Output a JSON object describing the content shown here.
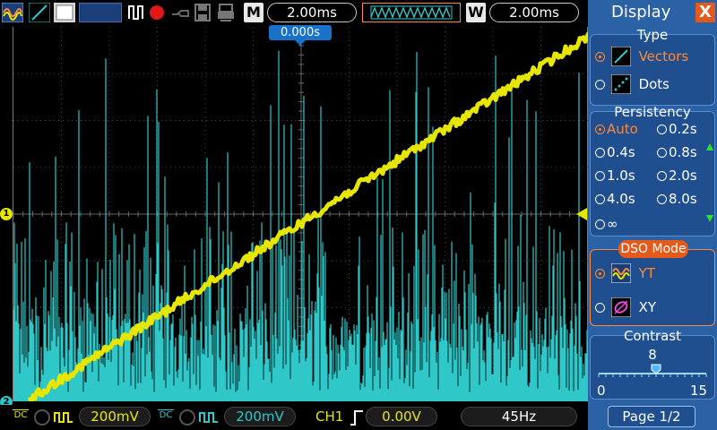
{
  "colors": {
    "ch1": "#e6e600",
    "ch2": "#2fc7c7",
    "accent": "#ff8a3c",
    "menu_bg": "#2b62a6",
    "trigger_marker": "#1a72c8"
  },
  "toolbar": {
    "icons": [
      "cursor-measure-icon",
      "vectors-display-icon",
      "color-grid-icon",
      "run-stop-icon",
      "record-icon",
      "probe-icon",
      "save-icon",
      "print-icon"
    ],
    "memory_label": "M",
    "memory_timebase": "2.00ms",
    "window_label": "W",
    "window_timebase": "2.00ms"
  },
  "screen": {
    "trigger_position": "0.000s",
    "ch1_marker": "1",
    "ch2_marker": "2"
  },
  "bottom": {
    "ch1_coupling": "DC",
    "ch1_scale": "200mV",
    "ch2_coupling": "DC",
    "ch2_scale": "200mV",
    "trigger_source": "CH1",
    "trigger_edge_icon": "rising-edge-icon",
    "trigger_level": "0.00V",
    "frequency": "45Hz"
  },
  "menu": {
    "title": "Display",
    "close_label": "X",
    "type": {
      "title": "Type",
      "options": [
        {
          "label": "Vectors",
          "selected": true,
          "icon": "vectors-icon"
        },
        {
          "label": "Dots",
          "selected": false,
          "icon": "dots-icon"
        }
      ]
    },
    "persistency": {
      "title": "Persistency",
      "options": [
        {
          "label": "Auto",
          "selected": true
        },
        {
          "label": "0.2s",
          "selected": false
        },
        {
          "label": "0.4s",
          "selected": false
        },
        {
          "label": "0.8s",
          "selected": false
        },
        {
          "label": "1.0s",
          "selected": false
        },
        {
          "label": "2.0s",
          "selected": false
        },
        {
          "label": "4.0s",
          "selected": false
        },
        {
          "label": "8.0s",
          "selected": false
        },
        {
          "label": "∞",
          "selected": false
        }
      ]
    },
    "dso_mode": {
      "title": "DSO Mode",
      "options": [
        {
          "label": "YT",
          "selected": true,
          "icon": "yt-mode-icon"
        },
        {
          "label": "XY",
          "selected": false,
          "icon": "xy-mode-icon"
        }
      ]
    },
    "contrast": {
      "title": "Contrast",
      "value": 8,
      "min": 0,
      "max": 15,
      "value_label": "8",
      "min_label": "0",
      "max_label": "15"
    },
    "page": "Page 1/2"
  }
}
